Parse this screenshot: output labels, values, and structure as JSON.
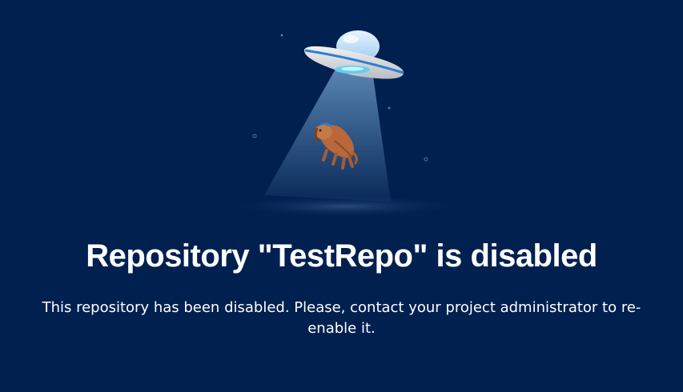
{
  "page": {
    "title": "Repository \"TestRepo\" is disabled",
    "message": "This repository has been disabled. Please, contact your project administrator to re-enable it."
  },
  "illustration": {
    "icon": "ufo-abducting-dog-icon",
    "background_color": "#002050"
  }
}
